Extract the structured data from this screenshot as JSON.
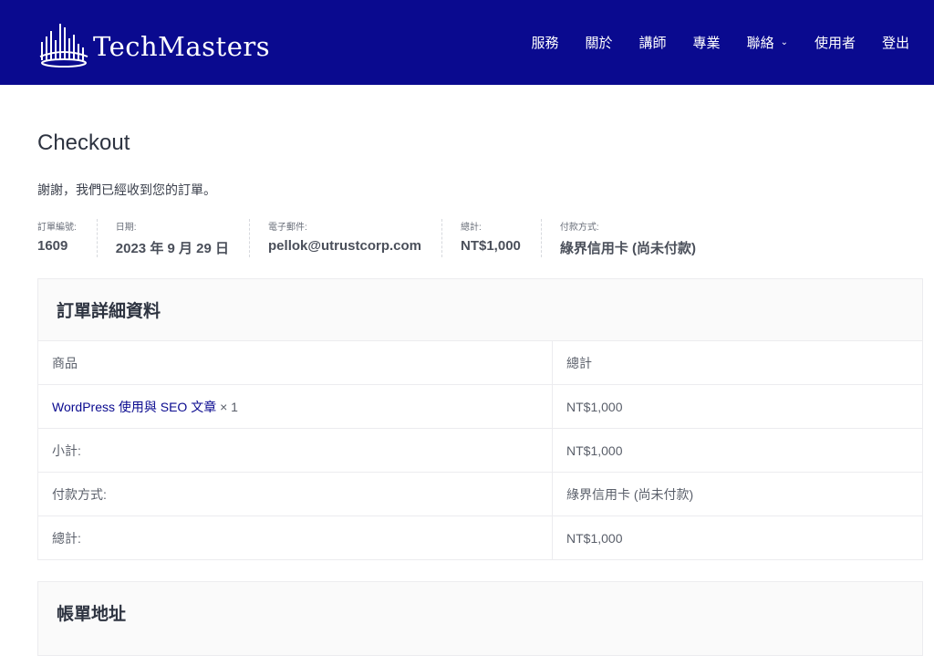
{
  "header": {
    "logo_text": "TechMasters",
    "nav": [
      {
        "label": "服務"
      },
      {
        "label": "關於"
      },
      {
        "label": "講師"
      },
      {
        "label": "專業"
      },
      {
        "label": "聯絡",
        "has_dropdown": true
      },
      {
        "label": "使用者"
      },
      {
        "label": "登出"
      }
    ],
    "background_color": "#0a0a8f"
  },
  "page": {
    "title": "Checkout",
    "thanks_message": "謝謝，我們已經收到您的訂單。"
  },
  "order_overview": [
    {
      "label": "訂單編號:",
      "value": "1609"
    },
    {
      "label": "日期:",
      "value": "2023 年 9 月 29 日"
    },
    {
      "label": "電子郵件:",
      "value": "pellok@utrustcorp.com"
    },
    {
      "label": "總計:",
      "value": "NT$1,000"
    },
    {
      "label": "付款方式:",
      "value": "綠界信用卡 (尚未付款)"
    }
  ],
  "order_details": {
    "title": "訂單詳細資料",
    "header": {
      "product": "商品",
      "total": "總計"
    },
    "item": {
      "name": "WordPress 使用與 SEO 文章",
      "qty": "× 1",
      "total": "NT$1,000"
    },
    "rows": [
      {
        "label": "小計:",
        "value": "NT$1,000"
      },
      {
        "label": "付款方式:",
        "value": "綠界信用卡 (尚未付款)"
      },
      {
        "label": "總計:",
        "value": "NT$1,000"
      }
    ]
  },
  "billing": {
    "title": "帳單地址"
  }
}
